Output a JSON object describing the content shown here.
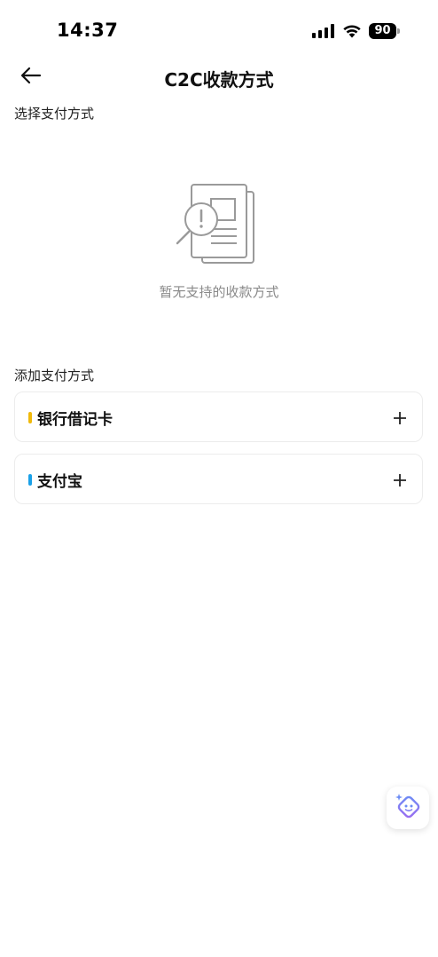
{
  "status_bar": {
    "time": "14:37",
    "battery": "90"
  },
  "header": {
    "title": "C2C收款方式"
  },
  "select_section": {
    "label": "选择支付方式",
    "empty_text": "暂无支持的收款方式"
  },
  "add_section": {
    "label": "添加支付方式",
    "methods": [
      {
        "label": "银行借记卡",
        "accent_color": "#F0B90B"
      },
      {
        "label": "支付宝",
        "accent_color": "#1AA1E8"
      }
    ]
  },
  "icons": {
    "back": "arrow-left-icon",
    "empty": "document-search-icon",
    "add": "plus-icon",
    "assistant": "ai-assistant-icon"
  }
}
